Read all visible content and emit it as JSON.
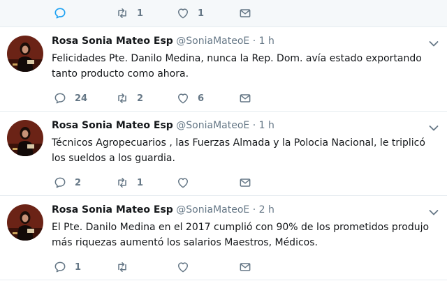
{
  "top_actions": {
    "reply_count": "",
    "retweet_count": "1",
    "like_count": "1"
  },
  "tweets": [
    {
      "name": "Rosa Sonia Mateo Esp",
      "handle": "@SoniaMateoE",
      "separator": "·",
      "time": "1 h",
      "text": "Felicidades Pte. Danilo Medina, nunca la Rep. Dom. avía estado exportando tanto producto como ahora.",
      "reply_count": "24",
      "retweet_count": "2",
      "like_count": "6"
    },
    {
      "name": "Rosa Sonia Mateo Esp",
      "handle": "@SoniaMateoE",
      "separator": "·",
      "time": "1 h",
      "text": "Técnicos Agropecuarios , las Fuerzas Almada y la Polocia Nacional, le triplicó los sueldos a los guardia.",
      "reply_count": "2",
      "retweet_count": "1",
      "like_count": ""
    },
    {
      "name": "Rosa Sonia Mateo Esp",
      "handle": "@SoniaMateoE",
      "separator": "·",
      "time": "2 h",
      "text": "El Pte. Danilo Medina en el 2017 cumplió con 90% de los prometidos produjo más riquezas aumentó los salarios Maestros, Médicos.",
      "reply_count": "1",
      "retweet_count": "",
      "like_count": ""
    }
  ],
  "icons": {
    "reply": "reply-icon",
    "retweet": "retweet-icon",
    "like": "heart-icon",
    "dm": "envelope-icon",
    "caret": "chevron-down-icon"
  },
  "colors": {
    "icon_active": "#1da1f2",
    "icon_default": "#657786",
    "name": "#14171a",
    "secondary": "#657786",
    "divider": "#e6ecf0"
  }
}
